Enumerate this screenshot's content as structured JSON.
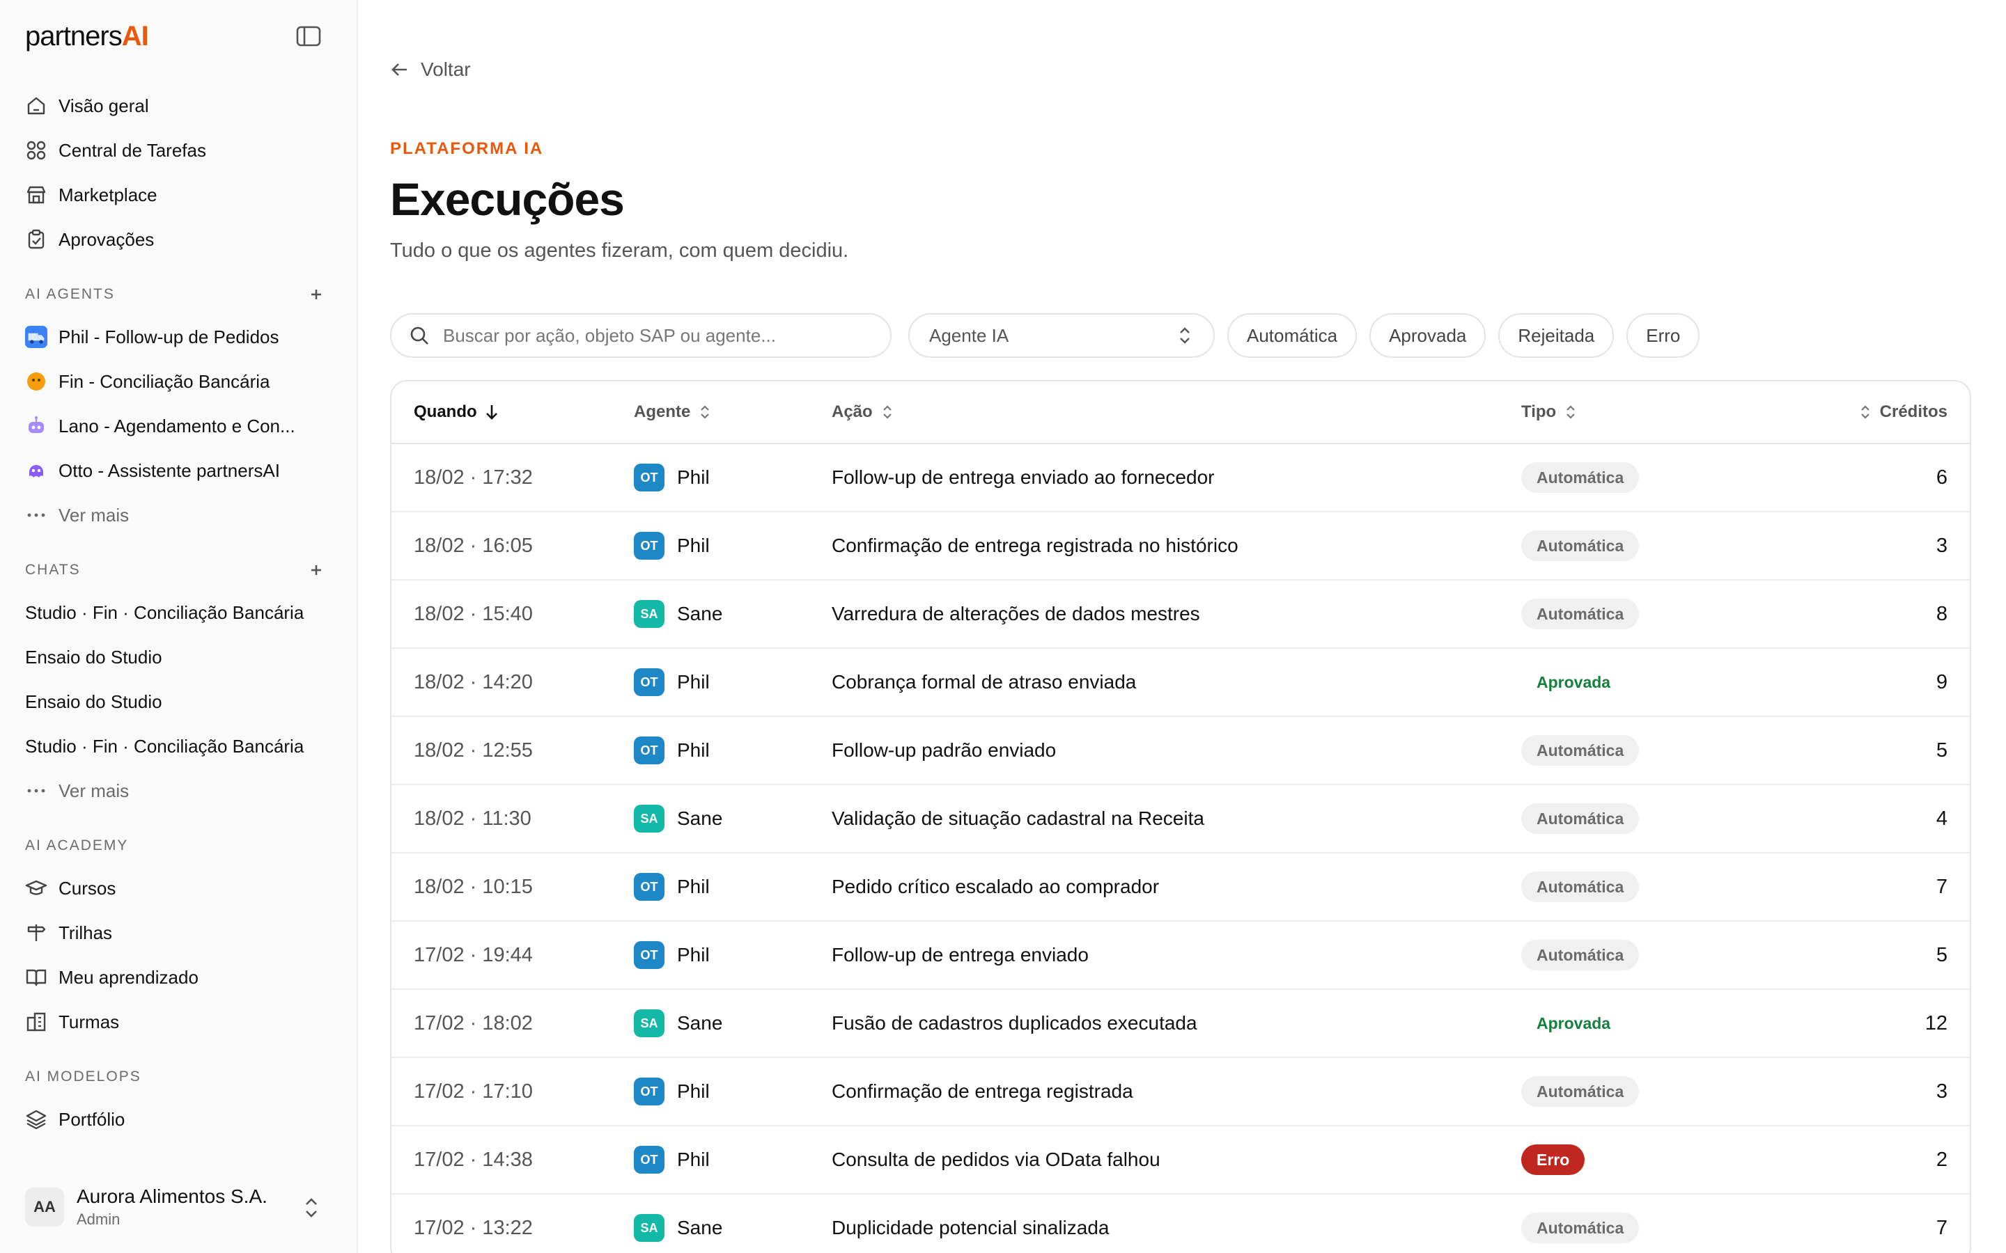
{
  "brand": {
    "name": "partners",
    "suffix": "AI"
  },
  "nav": [
    {
      "label": "Visão geral",
      "icon": "home-icon"
    },
    {
      "label": "Central de Tarefas",
      "icon": "grid-icon"
    },
    {
      "label": "Marketplace",
      "icon": "store-icon"
    },
    {
      "label": "Aprovações",
      "icon": "clipboard-check-icon"
    }
  ],
  "agents_section": {
    "title": "AI AGENTS",
    "items": [
      {
        "label": "Phil - Follow-up de Pedidos",
        "emoji": "🚛"
      },
      {
        "label": "Fin - Conciliação Bancária",
        "emoji": "😶"
      },
      {
        "label": "Lano - Agendamento e Con...",
        "emoji": "🤖"
      },
      {
        "label": "Otto - Assistente partnersAI",
        "emoji": "🐙"
      }
    ],
    "more": "Ver mais"
  },
  "chats_section": {
    "title": "CHATS",
    "items": [
      "Studio · Fin · Conciliação Bancária",
      "Ensaio do Studio",
      "Ensaio do Studio",
      "Studio · Fin · Conciliação Bancária"
    ],
    "more": "Ver mais"
  },
  "academy_section": {
    "title": "AI ACADEMY",
    "items": [
      {
        "label": "Cursos",
        "icon": "graduation-cap-icon"
      },
      {
        "label": "Trilhas",
        "icon": "signpost-icon"
      },
      {
        "label": "Meu aprendizado",
        "icon": "book-open-icon"
      },
      {
        "label": "Turmas",
        "icon": "building-icon"
      }
    ]
  },
  "modelops_section": {
    "title": "AI MODELOPS",
    "items": [
      {
        "label": "Portfólio",
        "icon": "layers-icon"
      }
    ]
  },
  "user": {
    "initials": "AA",
    "name": "Aurora Alimentos S.A.",
    "role": "Admin"
  },
  "header": {
    "back": "Voltar",
    "overline": "PLATAFORMA IA",
    "title": "Execuções",
    "subtitle": "Tudo o que os agentes fizeram, com quem decidiu."
  },
  "filters": {
    "search_placeholder": "Buscar por ação, objeto SAP ou agente...",
    "agent_select": "Agente IA",
    "chips": [
      "Automática",
      "Aprovada",
      "Rejeitada",
      "Erro"
    ]
  },
  "table": {
    "columns": {
      "when": "Quando",
      "agent": "Agente",
      "action": "Ação",
      "type": "Tipo",
      "credits": "Créditos"
    },
    "rows": [
      {
        "when": "18/02 · 17:32",
        "badge": "OT",
        "agent": "Phil",
        "action": "Follow-up de entrega enviado ao fornecedor",
        "type": "Automática",
        "type_kind": "auto",
        "credits": "6"
      },
      {
        "when": "18/02 · 16:05",
        "badge": "OT",
        "agent": "Phil",
        "action": "Confirmação de entrega registrada no histórico",
        "type": "Automática",
        "type_kind": "auto",
        "credits": "3"
      },
      {
        "when": "18/02 · 15:40",
        "badge": "SA",
        "agent": "Sane",
        "action": "Varredura de alterações de dados mestres",
        "type": "Automática",
        "type_kind": "auto",
        "credits": "8"
      },
      {
        "when": "18/02 · 14:20",
        "badge": "OT",
        "agent": "Phil",
        "action": "Cobrança formal de atraso enviada",
        "type": "Aprovada",
        "type_kind": "apr",
        "credits": "9"
      },
      {
        "when": "18/02 · 12:55",
        "badge": "OT",
        "agent": "Phil",
        "action": "Follow-up padrão enviado",
        "type": "Automática",
        "type_kind": "auto",
        "credits": "5"
      },
      {
        "when": "18/02 · 11:30",
        "badge": "SA",
        "agent": "Sane",
        "action": "Validação de situação cadastral na Receita",
        "type": "Automática",
        "type_kind": "auto",
        "credits": "4"
      },
      {
        "when": "18/02 · 10:15",
        "badge": "OT",
        "agent": "Phil",
        "action": "Pedido crítico escalado ao comprador",
        "type": "Automática",
        "type_kind": "auto",
        "credits": "7"
      },
      {
        "when": "17/02 · 19:44",
        "badge": "OT",
        "agent": "Phil",
        "action": "Follow-up de entrega enviado",
        "type": "Automática",
        "type_kind": "auto",
        "credits": "5"
      },
      {
        "when": "17/02 · 18:02",
        "badge": "SA",
        "agent": "Sane",
        "action": "Fusão de cadastros duplicados executada",
        "type": "Aprovada",
        "type_kind": "apr",
        "credits": "12"
      },
      {
        "when": "17/02 · 17:10",
        "badge": "OT",
        "agent": "Phil",
        "action": "Confirmação de entrega registrada",
        "type": "Automática",
        "type_kind": "auto",
        "credits": "3"
      },
      {
        "when": "17/02 · 14:38",
        "badge": "OT",
        "agent": "Phil",
        "action": "Consulta de pedidos via OData falhou",
        "type": "Erro",
        "type_kind": "err",
        "credits": "2"
      },
      {
        "when": "17/02 · 13:22",
        "badge": "SA",
        "agent": "Sane",
        "action": "Duplicidade potencial sinalizada",
        "type": "Automática",
        "type_kind": "auto",
        "credits": "7"
      }
    ]
  },
  "colors": {
    "accent": "#ea580c",
    "badge_ot": "#1e88c7",
    "badge_sa": "#14b8a6",
    "approved": "#15803d",
    "error": "#c0271f"
  }
}
